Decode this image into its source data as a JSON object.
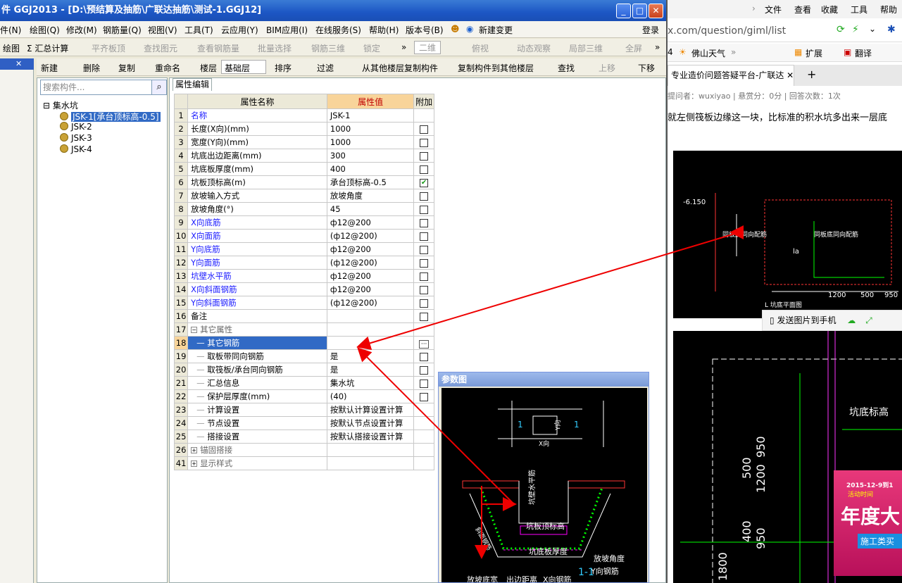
{
  "app": {
    "title": "件 GGJ2013 - [D:\\预结算及抽筋\\广联达抽筋\\测试-1.GGJ12]",
    "menus": [
      "件(N)",
      "绘图(Q)",
      "修改(M)",
      "钢筋量(Q)",
      "视图(V)",
      "工具(T)",
      "云应用(Y)",
      "BIM应用(I)",
      "在线服务(S)",
      "帮助(H)",
      "版本号(B)",
      "新建变更",
      "登录"
    ],
    "toolbar1": [
      "绘图",
      "Σ 汇总计算",
      "平齐板顶",
      "查找图元",
      "查看钢筋量",
      "批量选择",
      "钢筋三维",
      "锁定",
      "二维",
      "俯视",
      "动态观察",
      "局部三维",
      "全屏"
    ],
    "toolbar2": [
      "新建",
      "删除",
      "复制",
      "重命名",
      "楼层",
      "基础层",
      "排序",
      "过滤",
      "从其他楼层复制构件",
      "复制构件到其他楼层",
      "查找",
      "上移",
      "下移"
    ],
    "search_placeholder": "搜索构件...",
    "tree_root": "集水坑",
    "tree_items": [
      "JSK-1[承台顶标高-0.5]",
      "JSK-2",
      "JSK-3",
      "JSK-4"
    ],
    "prop_tab": "属性编辑",
    "col_headers": [
      "属性名称",
      "属性值",
      "附加"
    ],
    "rows": [
      {
        "n": "1",
        "name": "名称",
        "val": "JSK-1",
        "cb": "none",
        "style": "blue"
      },
      {
        "n": "2",
        "name": "长度(X向)(mm)",
        "val": "1000",
        "cb": "off",
        "style": ""
      },
      {
        "n": "3",
        "name": "宽度(Y向)(mm)",
        "val": "1000",
        "cb": "off",
        "style": ""
      },
      {
        "n": "4",
        "name": "坑底出边距离(mm)",
        "val": "300",
        "cb": "off",
        "style": ""
      },
      {
        "n": "5",
        "name": "坑底板厚度(mm)",
        "val": "400",
        "cb": "off",
        "style": ""
      },
      {
        "n": "6",
        "name": "坑板顶标高(m)",
        "val": "承台顶标高-0.5",
        "cb": "on",
        "style": ""
      },
      {
        "n": "7",
        "name": "放坡输入方式",
        "val": "放坡角度",
        "cb": "off",
        "style": ""
      },
      {
        "n": "8",
        "name": "放坡角度(°)",
        "val": "45",
        "cb": "off",
        "style": ""
      },
      {
        "n": "9",
        "name": "X向底筋",
        "val": "ф12@200",
        "cb": "off",
        "style": "blue"
      },
      {
        "n": "10",
        "name": "X向面筋",
        "val": "(ф12@200)",
        "cb": "off",
        "style": "blue"
      },
      {
        "n": "11",
        "name": "Y向底筋",
        "val": "ф12@200",
        "cb": "off",
        "style": "blue"
      },
      {
        "n": "12",
        "name": "Y向面筋",
        "val": "(ф12@200)",
        "cb": "off",
        "style": "blue"
      },
      {
        "n": "13",
        "name": "坑壁水平筋",
        "val": "ф12@200",
        "cb": "off",
        "style": "blue"
      },
      {
        "n": "14",
        "name": "X向斜面钢筋",
        "val": "ф12@200",
        "cb": "off",
        "style": "blue"
      },
      {
        "n": "15",
        "name": "Y向斜面钢筋",
        "val": "(ф12@200)",
        "cb": "off",
        "style": "blue"
      },
      {
        "n": "16",
        "name": "备注",
        "val": "",
        "cb": "off",
        "style": ""
      },
      {
        "n": "17",
        "name": "其它属性",
        "val": "",
        "cb": "none",
        "style": "group"
      },
      {
        "n": "18",
        "name": "其它钢筋",
        "val": "",
        "cb": "dots",
        "style": "sel"
      },
      {
        "n": "19",
        "name": "取板带同向钢筋",
        "val": "是",
        "cb": "off",
        "style": "sub"
      },
      {
        "n": "20",
        "name": "取筏板/承台同向钢筋",
        "val": "是",
        "cb": "off",
        "style": "sub"
      },
      {
        "n": "21",
        "name": "汇总信息",
        "val": "集水坑",
        "cb": "off",
        "style": "sub"
      },
      {
        "n": "22",
        "name": "保护层厚度(mm)",
        "val": "(40)",
        "cb": "off",
        "style": "sub"
      },
      {
        "n": "23",
        "name": "计算设置",
        "val": "按默认计算设置计算",
        "cb": "none",
        "style": "sub"
      },
      {
        "n": "24",
        "name": "节点设置",
        "val": "按默认节点设置计算",
        "cb": "none",
        "style": "sub"
      },
      {
        "n": "25",
        "name": "搭接设置",
        "val": "按默认搭接设置计算",
        "cb": "none",
        "style": "sub"
      },
      {
        "n": "26",
        "name": "锚固搭接",
        "val": "",
        "cb": "none",
        "style": "group"
      },
      {
        "n": "41",
        "name": "显示样式",
        "val": "",
        "cb": "none",
        "style": "group"
      }
    ],
    "param_title": "参数图",
    "diagram_labels": {
      "yh": "Y向",
      "xh": "X向",
      "one": "1",
      "wall_h": "坑壁水平筋",
      "slope_steel": "斜面钢筋",
      "top_elev": "坑板顶标高",
      "bottom_thick": "坑底板厚度",
      "slope_angle": "放坡角度",
      "y_steel": "Y向钢筋",
      "slope_width": "放坡底宽",
      "out_dist": "出边距离",
      "x_steel": "X向钢筋",
      "sect": "1-1"
    }
  },
  "browser": {
    "menu": [
      "文件",
      "查看",
      "收藏",
      "工具",
      "帮助"
    ],
    "address": "x.com/question/giml/list",
    "fav": [
      "4",
      "佛山天气",
      "扩展",
      "翻译"
    ],
    "tab_title": "专业造价问题答疑平台-广联达",
    "meta": "提问者：wuxiyao  |  悬赏分：0分  |  回答次数：1次",
    "question": "就左侧筏板边缘这一块，比标准的积水坑多出来一层底",
    "send_to_phone": "发送图片到手机",
    "cad1": {
      "elev": "-6.150",
      "label1": "同板底同向配筋",
      "label2": "同板底同向配筋",
      "dims": [
        "1200",
        "500",
        "950"
      ],
      "la": "la",
      "note": "L 坑底平面图"
    },
    "cad2": {
      "dims": [
        "950",
        "1200",
        "500",
        "400",
        "950",
        "1800"
      ],
      "label": "坑底标高"
    },
    "ad": {
      "date": "2015-12-9到1",
      "subtitle": "活动时间",
      "big": "年度大",
      "bottom": "施工类买"
    }
  }
}
